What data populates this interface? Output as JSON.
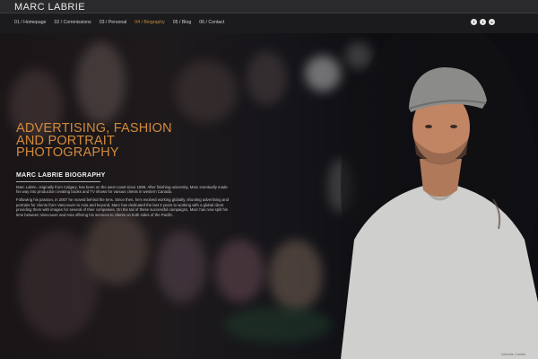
{
  "brand": {
    "name": "MARC LABRIE"
  },
  "nav": {
    "items": [
      {
        "label": "01 / Homepage"
      },
      {
        "label": "02 / Commissions"
      },
      {
        "label": "03 / Personal"
      },
      {
        "label": "04 / Biography",
        "active": true
      },
      {
        "label": "05 / Blog"
      },
      {
        "label": "06 / Contact"
      }
    ]
  },
  "social": [
    {
      "icon": "facebook-icon",
      "glyph": "f"
    },
    {
      "icon": "twitter-icon",
      "glyph": "t"
    },
    {
      "icon": "vimeo-icon",
      "glyph": "v"
    }
  ],
  "hero": {
    "headline_lines": [
      "ADVERTISING, FASHION",
      "AND PORTRAIT",
      "PHOTOGRAPHY"
    ],
    "bio_title": "MARC LABRIE BIOGRAPHY",
    "paragraphs": [
      "Marc Labrie, originally from Calgary, has been on the west coast since 1999. After finishing university, Marc eventually made his way into production creating books and TV shows for various clients in western Canada.",
      "Following his passion, in 2007 he moved behind the lens. Since then, he's evolved working globally, shooting advertising and portraits for clients from Vancouver to Asia and beyond. Marc has dedicated the last 3 years to working with a global client providing them with images for several of their companies. On the tail of these successful campaigns, Marc has now split his time between Vancouver and Asia offering his services to clients on both sides of the Pacific."
    ],
    "credit": "Website Credits"
  },
  "colors": {
    "accent": "#d38a3c",
    "active_nav": "#c7893a",
    "topbar": "#2a2a2c",
    "navbar": "#1b1b1d"
  }
}
